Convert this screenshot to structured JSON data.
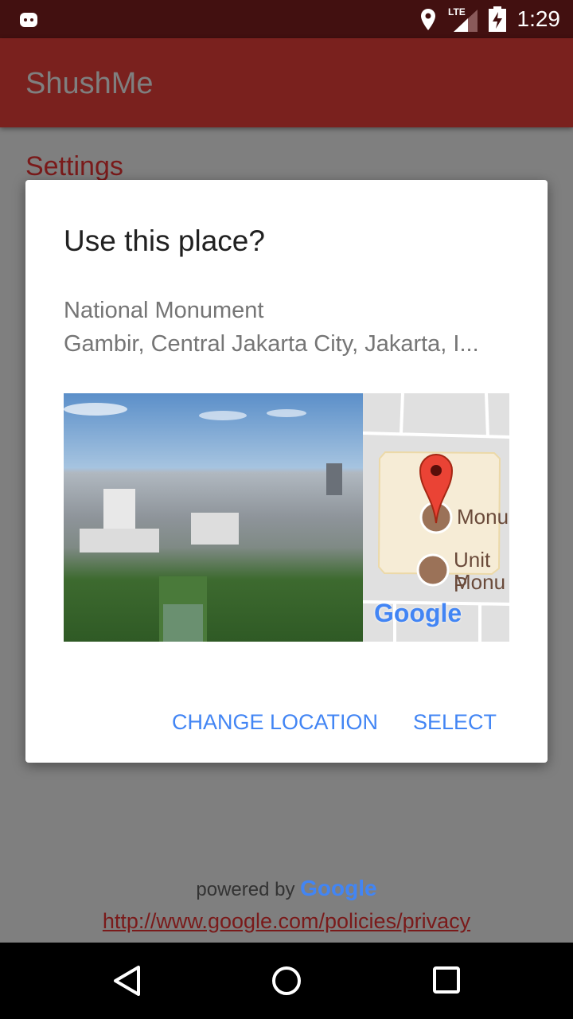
{
  "status_bar": {
    "time": "1:29",
    "network": "LTE",
    "icons": [
      "android-debug-icon",
      "location-icon",
      "signal-icon",
      "battery-charging-icon"
    ]
  },
  "app_bar": {
    "title": "ShushMe"
  },
  "page": {
    "section_title": "Settings"
  },
  "dialog": {
    "title": "Use this place?",
    "place_name": "National Monument",
    "place_address": "Gambir, Central Jakarta City, Jakarta, I...",
    "map": {
      "label_1": "Monu",
      "label_2a": "Unit P",
      "label_2b": "Monu",
      "logo": "Google"
    },
    "buttons": {
      "change_location": "CHANGE LOCATION",
      "select": "SELECT"
    }
  },
  "footer": {
    "powered_by": "powered by",
    "brand": "Google",
    "privacy_link": "http://www.google.com/policies/privacy"
  },
  "nav_bar": {
    "icons": [
      "back-icon",
      "home-icon",
      "recents-icon"
    ]
  }
}
